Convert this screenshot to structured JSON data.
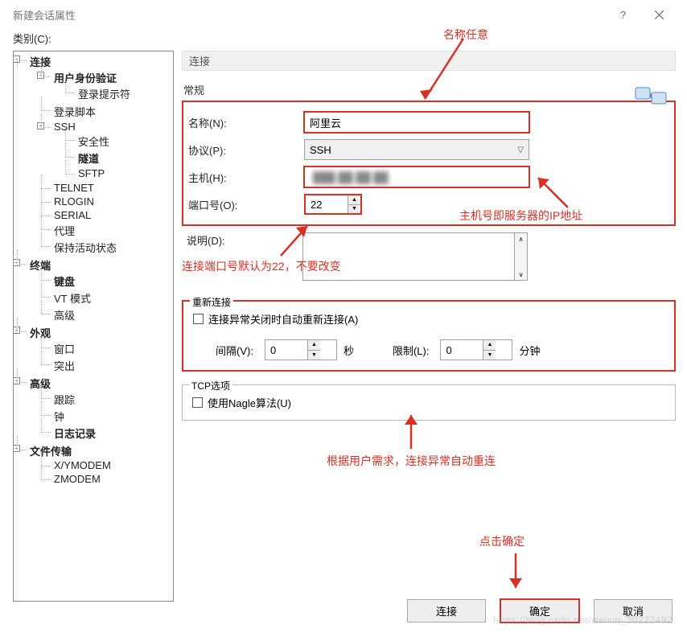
{
  "title": "新建会话属性",
  "category_label": "类别(C):",
  "tree": {
    "n_connection": "连接",
    "n_auth": "用户身份验证",
    "n_loginprompt": "登录提示符",
    "n_loginscript": "登录脚本",
    "n_ssh": "SSH",
    "n_security": "安全性",
    "n_tunnel": "隧道",
    "n_sftp": "SFTP",
    "n_telnet": "TELNET",
    "n_rlogin": "RLOGIN",
    "n_serial": "SERIAL",
    "n_proxy": "代理",
    "n_keepalive": "保持活动状态",
    "n_terminal": "终端",
    "n_keyboard": "键盘",
    "n_vtmode": "VT 模式",
    "n_advanced": "高级",
    "n_appearance": "外观",
    "n_window": "窗口",
    "n_highlight": "突出",
    "n_adv2": "高级",
    "n_trace": "跟踪",
    "n_bell": "钟",
    "n_log": "日志记录",
    "n_filetransfer": "文件传输",
    "n_xymodem": "X/YMODEM",
    "n_zmodem": "ZMODEM"
  },
  "content": {
    "section_title": "连接",
    "general_heading": "常规",
    "name_label": "名称(N):",
    "name_value": "阿里云",
    "protocol_label": "协议(P):",
    "protocol_value": "SSH",
    "host_label": "主机(H):",
    "host_value": "",
    "port_label": "端口号(O):",
    "port_value": "22",
    "desc_label": "说明(D):",
    "reconnect_legend": "重新连接",
    "reconnect_chk": "连接异常关闭时自动重新连接(A)",
    "interval_label": "间隔(V):",
    "interval_value": "0",
    "interval_unit": "秒",
    "limit_label": "限制(L):",
    "limit_value": "0",
    "limit_unit": "分钟",
    "tcp_legend": "TCP选项",
    "nagle_chk": "使用Nagle算法(U)"
  },
  "annotations": {
    "name_anno": "名称任意",
    "host_anno": "主机号即服务器的IP地址",
    "port_anno": "连接端口号默认为22，不要改变",
    "reconnect_anno": "根据用户需求，连接异常自动重连",
    "ok_anno": "点击确定"
  },
  "buttons": {
    "connect": "连接",
    "ok": "确定",
    "cancel": "取消"
  },
  "watermark": "https://blog.csdn.net/weixin_30222492"
}
